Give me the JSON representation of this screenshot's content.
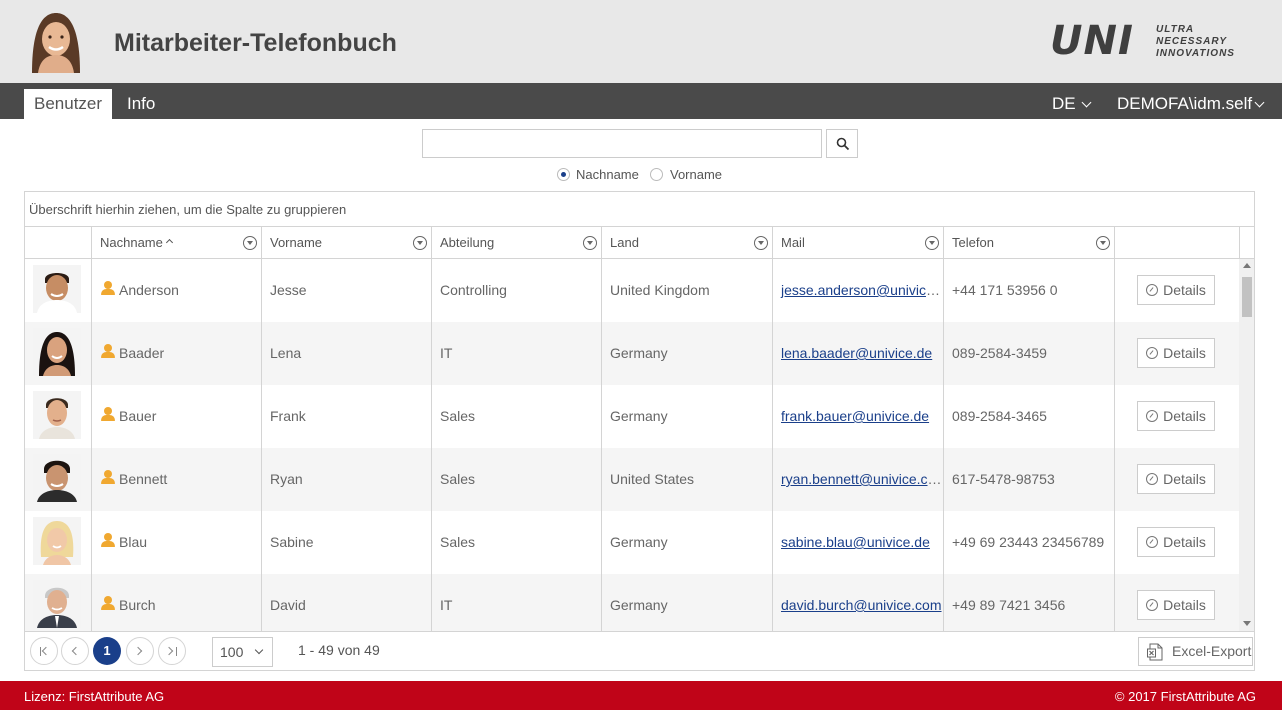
{
  "header": {
    "title": "Mitarbeiter-Telefonbuch",
    "brand": {
      "main": "UNI",
      "line1": "ULTRA",
      "line2": "NECESSARY",
      "line3": "INNOVATIONS"
    }
  },
  "nav": {
    "tabs": [
      {
        "label": "Benutzer",
        "active": true
      },
      {
        "label": "Info",
        "active": false
      }
    ],
    "language": "DE",
    "account": "DEMOFA\\idm.self"
  },
  "search": {
    "value": "",
    "placeholder": "",
    "options": [
      {
        "label": "Nachname",
        "checked": true
      },
      {
        "label": "Vorname",
        "checked": false
      }
    ]
  },
  "grid": {
    "group_hint": "Überschrift hierhin ziehen, um die Spalte zu gruppieren",
    "columns": {
      "lastname": "Nachname",
      "firstname": "Vorname",
      "department": "Abteilung",
      "country": "Land",
      "mail": "Mail",
      "phone": "Telefon"
    },
    "details_label": "Details",
    "rows": [
      {
        "lastname": "Anderson",
        "firstname": "Jesse",
        "department": "Controlling",
        "country": "United Kingdom",
        "mail": "jesse.anderson@univice...",
        "phone": "+44 171 53956 0"
      },
      {
        "lastname": "Baader",
        "firstname": "Lena",
        "department": "IT",
        "country": "Germany",
        "mail": "lena.baader@univice.de",
        "phone": "089-2584-3459"
      },
      {
        "lastname": "Bauer",
        "firstname": "Frank",
        "department": "Sales",
        "country": "Germany",
        "mail": "frank.bauer@univice.de",
        "phone": "089-2584-3465"
      },
      {
        "lastname": "Bennett",
        "firstname": "Ryan",
        "department": "Sales",
        "country": "United States",
        "mail": "ryan.bennett@univice.com",
        "phone": "617-5478-98753"
      },
      {
        "lastname": "Blau",
        "firstname": "Sabine",
        "department": "Sales",
        "country": "Germany",
        "mail": "sabine.blau@univice.de",
        "phone": "+49 69 23443 23456789"
      },
      {
        "lastname": "Burch",
        "firstname": "David",
        "department": "IT",
        "country": "Germany",
        "mail": "david.burch@univice.com",
        "phone": "+49 89 7421 3456"
      }
    ]
  },
  "pager": {
    "current_page": "1",
    "page_size": "100",
    "info": "1 - 49 von 49",
    "export_label": "Excel-Export"
  },
  "footer": {
    "license": "Lizenz: FirstAttribute AG",
    "copyright": "© 2017 FirstAttribute AG"
  },
  "colors": {
    "nav_bg": "#4a4a4a",
    "footer_bg": "#c00418",
    "accent": "#1a3f8a",
    "user_icon": "#f0a830"
  }
}
